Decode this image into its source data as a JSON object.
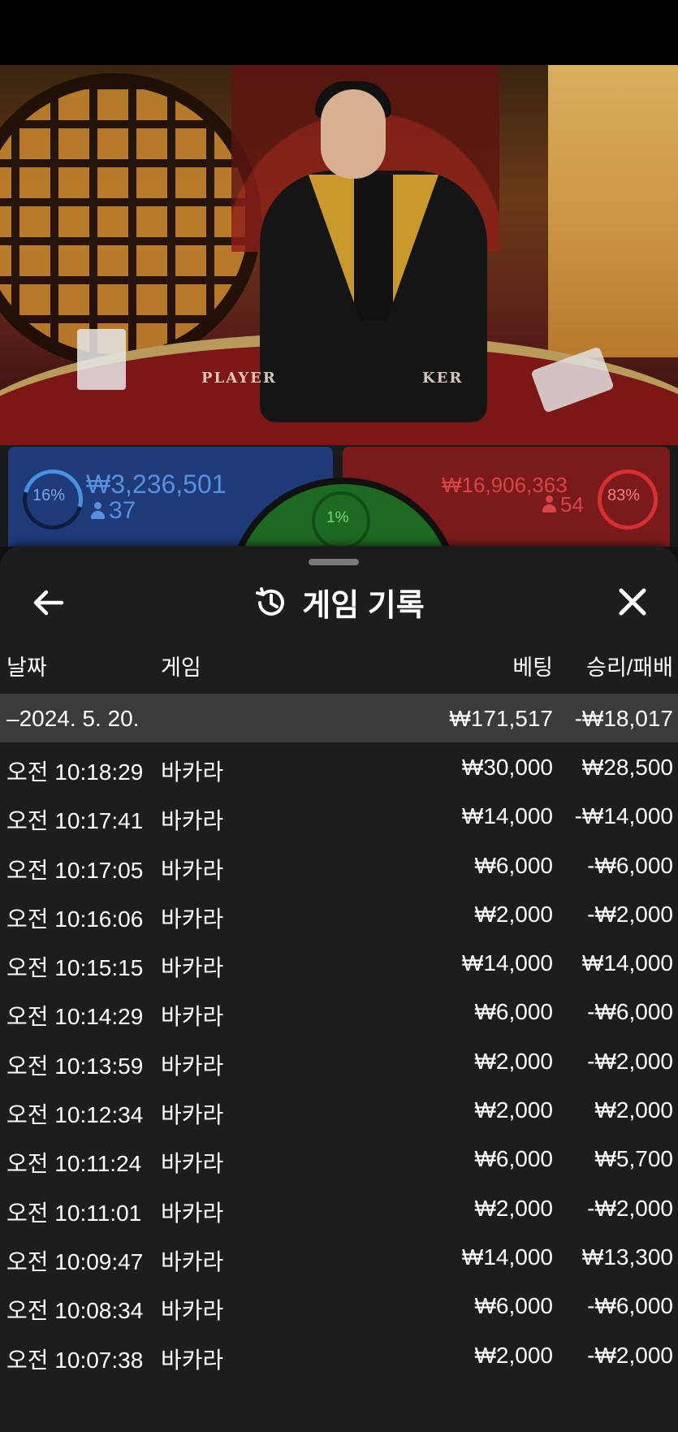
{
  "video": {
    "table_label_player": "PLAYER",
    "table_label_banker": "KER"
  },
  "bets": {
    "player": {
      "percent": "16%",
      "amount": "₩3,236,501",
      "count": "37",
      "color": "#4a90e2"
    },
    "tie": {
      "percent": "1%",
      "color": "#2e8b35"
    },
    "banker": {
      "percent": "83%",
      "amount": "₩16,906,363",
      "count": "54",
      "color": "#d83030"
    }
  },
  "sheet": {
    "title": "게임 기록",
    "icons": {
      "back": "arrow-left-icon",
      "history": "history-icon",
      "close": "close-icon"
    },
    "columns": {
      "date": "날짜",
      "game": "게임",
      "bet": "베팅",
      "result": "승리/패배"
    },
    "summary": {
      "date": "–2024. 5. 20.",
      "bet": "₩171,517",
      "result": "-₩18,017"
    },
    "rows": [
      {
        "time": "오전 10:18:29",
        "game": "바카라",
        "bet": "₩30,000",
        "result": "₩28,500"
      },
      {
        "time": "오전 10:17:41",
        "game": "바카라",
        "bet": "₩14,000",
        "result": "-₩14,000"
      },
      {
        "time": "오전 10:17:05",
        "game": "바카라",
        "bet": "₩6,000",
        "result": "-₩6,000"
      },
      {
        "time": "오전 10:16:06",
        "game": "바카라",
        "bet": "₩2,000",
        "result": "-₩2,000"
      },
      {
        "time": "오전 10:15:15",
        "game": "바카라",
        "bet": "₩14,000",
        "result": "₩14,000"
      },
      {
        "time": "오전 10:14:29",
        "game": "바카라",
        "bet": "₩6,000",
        "result": "-₩6,000"
      },
      {
        "time": "오전 10:13:59",
        "game": "바카라",
        "bet": "₩2,000",
        "result": "-₩2,000"
      },
      {
        "time": "오전 10:12:34",
        "game": "바카라",
        "bet": "₩2,000",
        "result": "₩2,000"
      },
      {
        "time": "오전 10:11:24",
        "game": "바카라",
        "bet": "₩6,000",
        "result": "₩5,700"
      },
      {
        "time": "오전 10:11:01",
        "game": "바카라",
        "bet": "₩2,000",
        "result": "-₩2,000"
      },
      {
        "time": "오전 10:09:47",
        "game": "바카라",
        "bet": "₩14,000",
        "result": "₩13,300"
      },
      {
        "time": "오전 10:08:34",
        "game": "바카라",
        "bet": "₩6,000",
        "result": "-₩6,000"
      },
      {
        "time": "오전 10:07:38",
        "game": "바카라",
        "bet": "₩2,000",
        "result": "-₩2,000"
      }
    ]
  }
}
